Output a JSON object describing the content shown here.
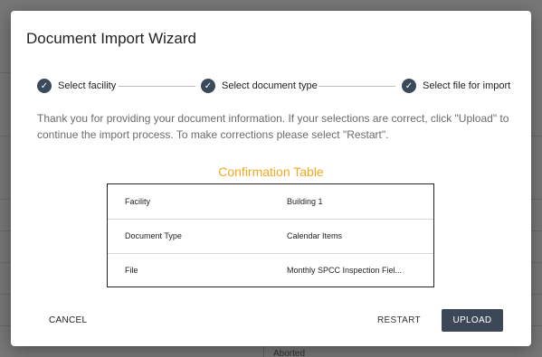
{
  "dialog": {
    "title": "Document Import Wizard"
  },
  "stepper": {
    "steps": [
      {
        "label": "Select facility",
        "status": "complete",
        "icon": "check-circle-icon"
      },
      {
        "label": "Select document type",
        "status": "complete",
        "icon": "check-circle-icon"
      },
      {
        "label": "Select file for import",
        "status": "complete",
        "icon": "check-circle-icon"
      }
    ]
  },
  "info_text": "Thank you for providing your document information. If your selections are correct, click \"Upload\" to continue the import process. To make corrections please select \"Restart\".",
  "confirmation": {
    "title": "Confirmation Table",
    "rows": [
      {
        "label": "Facility",
        "value": "Building 1"
      },
      {
        "label": "Document Type",
        "value": "Calendar Items"
      },
      {
        "label": "File",
        "value": "Monthly SPCC Inspection Fiel..."
      }
    ]
  },
  "actions": {
    "cancel": "CANCEL",
    "restart": "RESTART",
    "upload": "UPLOAD"
  },
  "background": {
    "status_text": "Aborted"
  },
  "colors": {
    "accent_title": "#f2a91f",
    "step_icon": "#3b4a5a",
    "upload_button": "#3c4858"
  }
}
